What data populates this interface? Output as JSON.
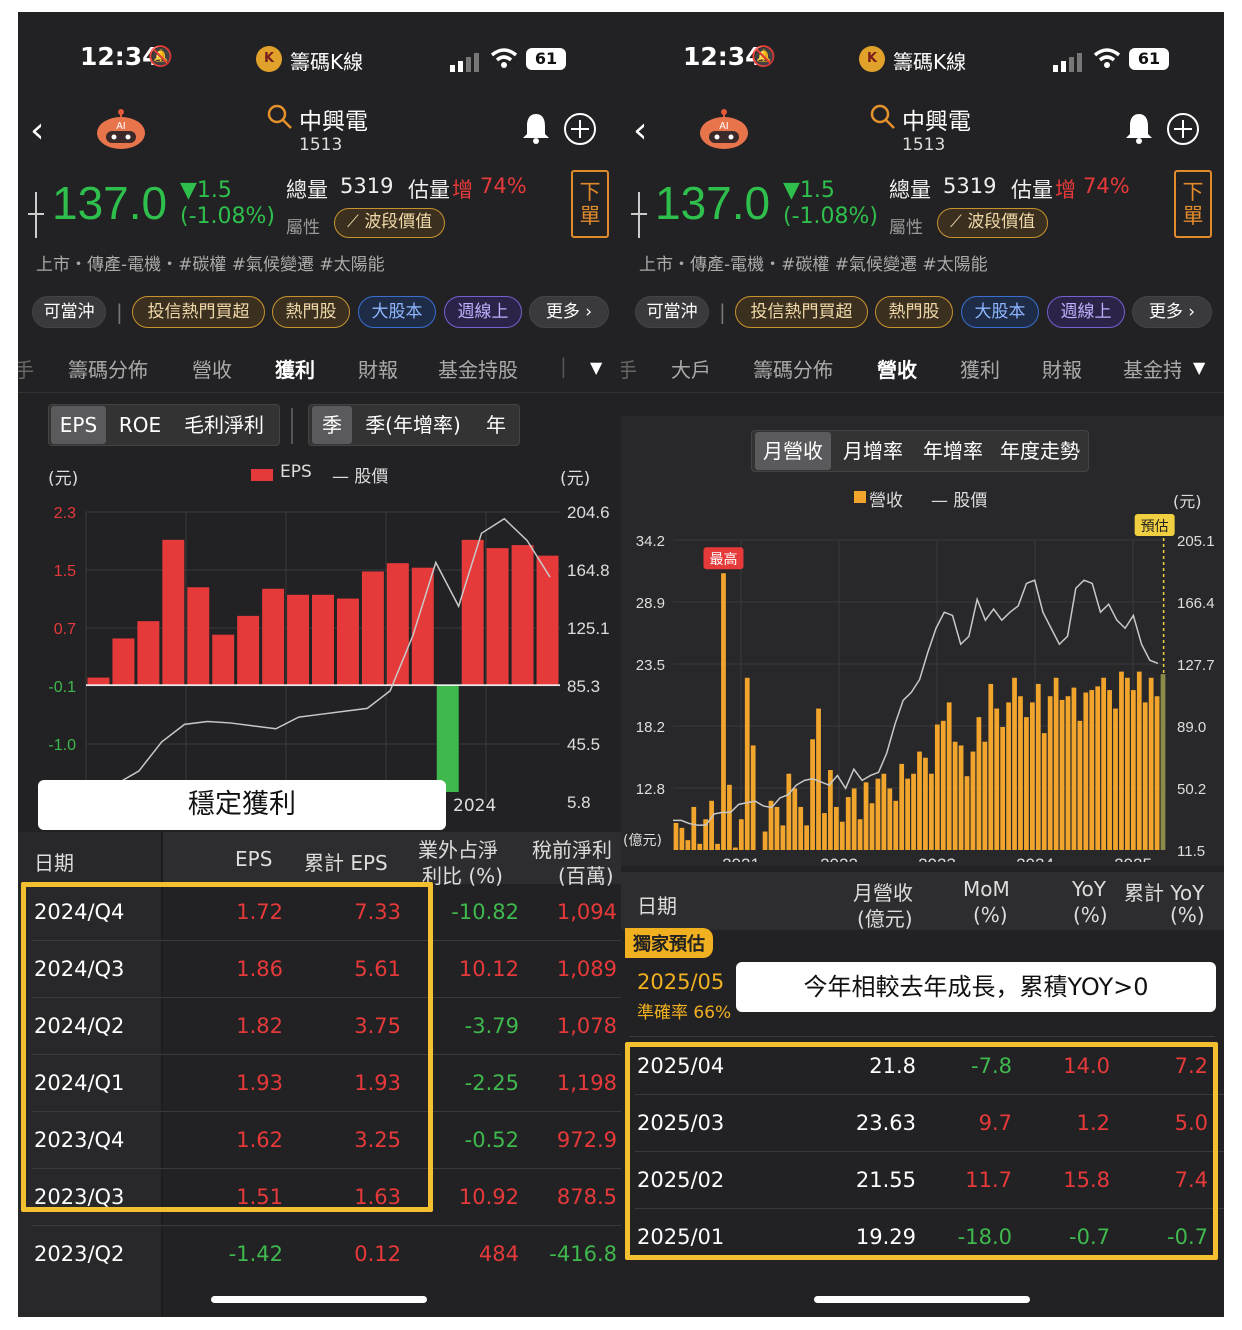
{
  "status": {
    "time": "12:34",
    "app_name": "籌碼K線",
    "battery": "61"
  },
  "stock": {
    "name": "中興電",
    "code": "1513",
    "price": "137.0",
    "change": "▼1.5",
    "change_pct": "(-1.08%)",
    "volume_label": "總量",
    "volume": "5319",
    "est_label": "估量",
    "est_dir": "增",
    "est_pct": "74%",
    "attr_label": "屬性",
    "attr_value": "波段價值",
    "tags": "上市・傳產-電機・#碳權 #氣候變遷 #太陽能",
    "order_label": "下單"
  },
  "pills": [
    "可當沖",
    "投信熱門買超",
    "熱門股",
    "大股本",
    "週線上",
    "更多 ›"
  ],
  "colors": {
    "up": "#e6393a",
    "down": "#3fb84e",
    "revenue": "#f2a52c",
    "highlight": "#f4c030"
  },
  "left": {
    "nav_tabs": [
      "籌碼分佈",
      "營收",
      "獲利",
      "財報",
      "基金持股"
    ],
    "active_tab": "獲利",
    "seg1": [
      "EPS",
      "ROE",
      "毛利淨利"
    ],
    "seg2": [
      "季",
      "季(年增率)",
      "年"
    ],
    "unit_left": "(元)",
    "unit_right": "(元)",
    "legend_eps": "EPS",
    "legend_price": "股價",
    "y_left_ticks": [
      "2.3",
      "1.5",
      "0.7",
      "-0.1",
      "-1.0"
    ],
    "y_right_ticks": [
      "204.6",
      "164.8",
      "125.1",
      "85.3",
      "45.5",
      "5.8"
    ],
    "x_label": "2024",
    "chart_data": {
      "type": "bar",
      "values": [
        0.1,
        0.62,
        0.85,
        1.93,
        1.3,
        0.67,
        0.92,
        1.28,
        1.2,
        1.2,
        1.15,
        1.51,
        1.62,
        1.56,
        -1.42,
        1.93,
        1.82,
        1.86,
        1.72
      ],
      "price_line": [
        18,
        27,
        47,
        59,
        61,
        60,
        58,
        56,
        64,
        66,
        68,
        70,
        82,
        120,
        170,
        140,
        190,
        200,
        185,
        160
      ],
      "ylim": [
        -1.42,
        2.3
      ],
      "y2lim": [
        5.8,
        204.6
      ]
    },
    "callout": "穩定獲利",
    "table_headers": {
      "date": "日期",
      "eps": "EPS",
      "cum_eps": "累計 EPS",
      "nonop_1": "業外占淨",
      "nonop_2": "利比 (%)",
      "pretax_1": "稅前淨利",
      "pretax_2": "(百萬)"
    },
    "rows": [
      {
        "date": "2024/Q4",
        "eps": "1.72",
        "cum": "7.33",
        "nonop": "-10.82",
        "pretax": "1,094"
      },
      {
        "date": "2024/Q3",
        "eps": "1.86",
        "cum": "5.61",
        "nonop": "10.12",
        "pretax": "1,089"
      },
      {
        "date": "2024/Q2",
        "eps": "1.82",
        "cum": "3.75",
        "nonop": "-3.79",
        "pretax": "1,078"
      },
      {
        "date": "2024/Q1",
        "eps": "1.93",
        "cum": "1.93",
        "nonop": "-2.25",
        "pretax": "1,198"
      },
      {
        "date": "2023/Q4",
        "eps": "1.62",
        "cum": "3.25",
        "nonop": "-0.52",
        "pretax": "972.9"
      },
      {
        "date": "2023/Q3",
        "eps": "1.51",
        "cum": "1.63",
        "nonop": "10.92",
        "pretax": "878.5"
      },
      {
        "date": "2023/Q2",
        "eps": "-1.42",
        "cum": "0.12",
        "nonop": "484",
        "pretax": "-416.8"
      }
    ]
  },
  "right": {
    "nav_tabs": [
      "大戶",
      "籌碼分佈",
      "營收",
      "獲利",
      "財報",
      "基金持"
    ],
    "active_tab": "營收",
    "seg": [
      "月營收",
      "月增率",
      "年增率",
      "年度走勢"
    ],
    "legend_rev": "營收",
    "legend_price": "股價",
    "unit_left": "(億元)",
    "unit_right": "(元)",
    "forecast_tag": "預估",
    "high_tag": "最高",
    "y_left_ticks": [
      "34.2",
      "28.9",
      "23.5",
      "18.2",
      "12.8"
    ],
    "y_right_ticks": [
      "205.1",
      "166.4",
      "127.7",
      "89.0",
      "50.2",
      "11.5"
    ],
    "x_labels": [
      "2021",
      "2022",
      "2023",
      "2024",
      "2025"
    ],
    "chart_data": {
      "type": "bar",
      "values": [
        11.2,
        10.8,
        9.8,
        12.5,
        9.5,
        11.5,
        13.0,
        9.5,
        31.5,
        14.3,
        9.2,
        11.5,
        23.0,
        17.5,
        9.0,
        10.5,
        13.0,
        12.5,
        11.0,
        15.2,
        14.0,
        12.5,
        11.0,
        18.0,
        20.5,
        12.0,
        15.5,
        12.5,
        11.3,
        13.3,
        14.0,
        11.5,
        14.5,
        12.8,
        14.8,
        15.2,
        14.0,
        13.0,
        16.0,
        14.8,
        15.2,
        17.0,
        16.5,
        15.2,
        19.2,
        19.5,
        21.0,
        17.8,
        17.5,
        15.0,
        17.0,
        19.8,
        17.8,
        22.5,
        20.5,
        19.0,
        21.0,
        23.0,
        21.5,
        19.8,
        21.0,
        22.5,
        18.5,
        21.5,
        23.0,
        21.2,
        21.5,
        22.2,
        19.5,
        21.8,
        22.0,
        22.3,
        23.0,
        22.0,
        20.5,
        23.5,
        23.0,
        22.0,
        23.5,
        21.0,
        23.0,
        21.5
      ],
      "forecast_value": 23.3,
      "price_line": [
        30,
        30,
        28,
        27,
        27,
        34,
        35,
        35,
        40,
        41,
        42,
        39,
        38,
        44,
        46,
        52,
        55,
        56,
        54,
        52,
        58,
        50,
        62,
        55,
        58,
        60,
        72,
        90,
        105,
        110,
        118,
        135,
        150,
        160,
        158,
        140,
        145,
        168,
        155,
        162,
        155,
        160,
        164,
        178,
        180,
        160,
        150,
        140,
        145,
        175,
        180,
        178,
        160,
        165,
        155,
        150,
        158,
        140,
        130,
        128
      ],
      "ylim": [
        9.0,
        34.2
      ],
      "y2lim": [
        11.5,
        205.1
      ]
    },
    "table_headers": {
      "date": "日期",
      "rev_1": "月營收",
      "rev_2": "(億元)",
      "mom_1": "MoM",
      "mom_2": "(%)",
      "yoy_1": "YoY",
      "yoy_2": "(%)",
      "cum_1": "累計 YoY",
      "cum_2": "(%)"
    },
    "exclusive_tag": "獨家預估",
    "forecast_row": {
      "date": "2025/05",
      "accuracy": "準確率 66%"
    },
    "callout": "今年相較去年成長，累積YOY>0",
    "rows": [
      {
        "date": "2025/04",
        "rev": "21.8",
        "mom": "-7.8",
        "yoy": "14.0",
        "cum": "7.2"
      },
      {
        "date": "2025/03",
        "rev": "23.63",
        "mom": "9.7",
        "yoy": "1.2",
        "cum": "5.0"
      },
      {
        "date": "2025/02",
        "rev": "21.55",
        "mom": "11.7",
        "yoy": "15.8",
        "cum": "7.4"
      },
      {
        "date": "2025/01",
        "rev": "19.29",
        "mom": "-18.0",
        "yoy": "-0.7",
        "cum": "-0.7"
      }
    ]
  }
}
